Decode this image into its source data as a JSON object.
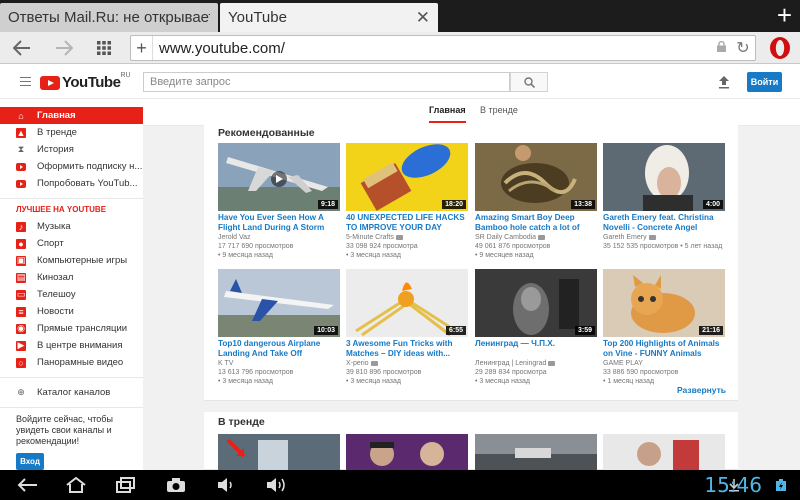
{
  "browser": {
    "tabs": [
      {
        "title": "Ответы Mail.Ru: не открывается"
      },
      {
        "title": "YouTube"
      }
    ],
    "new_tab": "+",
    "url": "www.youtube.com/",
    "omni_plus": "+",
    "accent_color": "#d01010"
  },
  "youtube": {
    "logo_text": "YouTube",
    "logo_region": "RU",
    "search_placeholder": "Введите запрос",
    "signin_label": "Войти",
    "tabs": [
      {
        "label": "Главная"
      },
      {
        "label": "В тренде"
      }
    ],
    "brand_red": "#e62117",
    "link_blue": "#167ac6"
  },
  "sidebar": {
    "main_items": [
      {
        "label": "Главная",
        "icon": "home-icon"
      },
      {
        "label": "В тренде",
        "icon": "flame-icon"
      },
      {
        "label": "История",
        "icon": "hourglass-icon"
      },
      {
        "label": "Оформить подписку н...",
        "icon": "youtube-red-icon"
      },
      {
        "label": "Попробовать YouTub...",
        "icon": "youtube-red-icon"
      }
    ],
    "section_title": "ЛУЧШЕЕ НА YOUTUBE",
    "best_items": [
      {
        "label": "Музыка",
        "icon": "music-icon"
      },
      {
        "label": "Спорт",
        "icon": "sport-icon"
      },
      {
        "label": "Компьютерные игры",
        "icon": "gaming-icon"
      },
      {
        "label": "Кинозал",
        "icon": "movies-icon"
      },
      {
        "label": "Телешоу",
        "icon": "tv-icon"
      },
      {
        "label": "Новости",
        "icon": "news-icon"
      },
      {
        "label": "Прямые трансляции",
        "icon": "live-icon"
      },
      {
        "label": "В центре внимания",
        "icon": "spotlight-icon"
      },
      {
        "label": "Панорамные видео",
        "icon": "360-icon"
      }
    ],
    "catalog": {
      "label": "Каталог каналов",
      "icon": "plus-circle-icon"
    },
    "promo_text": "Войдите сейчас, чтобы увидеть свои каналы и рекомендации!",
    "login_label": "Вход"
  },
  "recommended": {
    "title": "Рекомендованные",
    "expand_label": "Развернуть",
    "videos": [
      {
        "title": "Have You Ever Seen How A Flight Land During A Storm Watch The...",
        "channel": "Jerold Vaz",
        "views": "17 717 690 просмотров",
        "age": "9 месяца назад",
        "duration": "9:18"
      },
      {
        "title": "40 UNEXPECTED LIFE HACKS TO IMPROVE YOUR DAY",
        "channel": "5-Minute Crafts",
        "views": "33 098 924 просмотра",
        "age": "3 месяца назад",
        "duration": "18:20"
      },
      {
        "title": "Amazing Smart Boy Deep Bamboo hole catch a lot of eels...",
        "channel": "SR Daily Cambodia",
        "views": "49 061 876 просмотров",
        "age": "9 месяцев назад",
        "duration": "13:38"
      },
      {
        "title": "Gareth Emery feat. Christina Novelli - Concrete Angel [Official...",
        "channel": "Gareth Emery",
        "views": "35 152 535 просмотров",
        "age": "5 лет назад",
        "duration": "4:00"
      },
      {
        "title": "Top10 dangerous Airplane Landing And Take Off",
        "channel": "K TV",
        "views": "13 613 796 просмотров",
        "age": "3 месяца назад",
        "duration": "10:03"
      },
      {
        "title": "3 Awesome Fun Tricks with Matches – DIY ideas with...",
        "channel": "X-perio",
        "views": "39 810 896 просмотров",
        "age": "3 месяца назад",
        "duration": "6:55"
      },
      {
        "title": "Ленинград — Ч.П.Х.",
        "channel": "Ленинград | Leningrad",
        "views": "29 289 834 просмотра",
        "age": "3 месяца назад",
        "duration": "3:59"
      },
      {
        "title": "Top 200 Highlights of Animals on Vine - FUNNY Animals",
        "channel": "GAME PLAY",
        "views": "33 886 590 просмотров",
        "age": "1 месяц назад",
        "duration": "21:16"
      }
    ]
  },
  "trending": {
    "title": "В тренде"
  },
  "system": {
    "clock": "15:46"
  }
}
